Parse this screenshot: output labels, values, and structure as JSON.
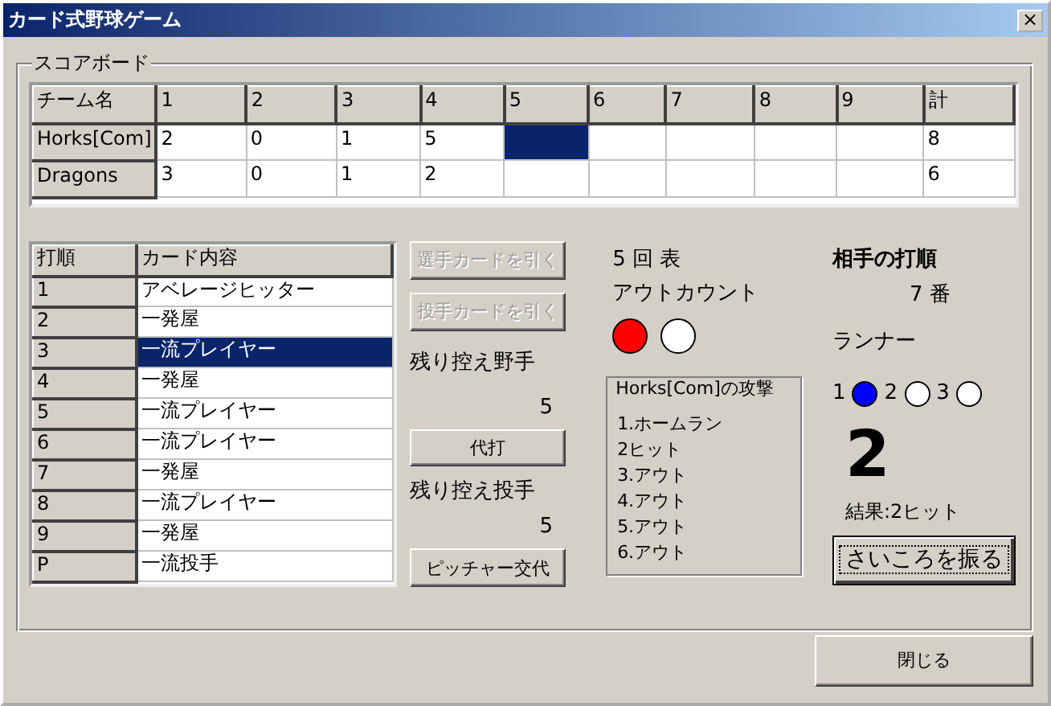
{
  "window": {
    "title": "カード式野球ゲーム",
    "close": "×"
  },
  "scoreboard": {
    "title": "スコアボード",
    "columns": [
      "チーム名",
      "1",
      "2",
      "3",
      "4",
      "5",
      "6",
      "7",
      "8",
      "9",
      "計"
    ],
    "rows": [
      {
        "cells": [
          {
            "text": "Horks[Com]",
            "selected": false
          },
          {
            "text": "2",
            "selected": false
          },
          {
            "text": "0",
            "selected": false
          },
          {
            "text": "1",
            "selected": false
          },
          {
            "text": "5",
            "selected": false
          },
          {
            "selected": true
          },
          {
            "selected": false
          },
          {
            "selected": false
          },
          {
            "selected": false
          },
          {
            "selected": false
          },
          {
            "text": "8",
            "selected": false
          }
        ]
      },
      {
        "cells": [
          {
            "text": "Dragons",
            "selected": false
          },
          {
            "text": "3",
            "selected": false
          },
          {
            "text": "0",
            "selected": false
          },
          {
            "text": "1",
            "selected": false
          },
          {
            "text": "2",
            "selected": false
          },
          {
            "selected": false
          },
          {
            "selected": false
          },
          {
            "selected": false
          },
          {
            "selected": false
          },
          {
            "selected": false
          },
          {
            "text": "6",
            "selected": false
          }
        ]
      }
    ],
    "lineup": {
      "columns": [
        "打順",
        "カード内容"
      ],
      "rows": [
        {
          "order": "1",
          "card": "アベレージヒッター",
          "selected": false
        },
        {
          "order": "2",
          "card": "一発屋",
          "selected": false
        },
        {
          "order": "3",
          "card": "一流プレイヤー",
          "selected": true
        },
        {
          "order": "4",
          "card": "一発屋",
          "selected": false
        },
        {
          "order": "5",
          "card": "一流プレイヤー",
          "selected": false
        },
        {
          "order": "6",
          "card": "一流プレイヤー",
          "selected": false
        },
        {
          "order": "7",
          "card": "一発屋",
          "selected": false
        },
        {
          "order": "8",
          "card": "一流プレイヤー",
          "selected": false
        },
        {
          "order": "9",
          "card": "一発屋",
          "selected": false
        },
        {
          "order": "P",
          "card": "一流投手",
          "selected": false
        }
      ]
    },
    "cards": {
      "draw_batter": {
        "label": "選手カードを引く",
        "disabled": true
      },
      "draw_pitcher": {
        "label": "投手カードを引く",
        "disabled": true
      },
      "bench_batters_label": "残り控え野手",
      "bench_batters": "5",
      "pinch_hit": {
        "label": "代打",
        "disabled": false
      },
      "bench_pitchers_label": "残り控え投手",
      "bench_pitchers": "5",
      "change_pitcher": {
        "label": "ピッチャー交代",
        "disabled": false
      }
    },
    "inning": "5 回 表",
    "outs": {
      "label": "アウトカウント",
      "lamps": [
        {
          "on": true
        },
        {
          "on": false
        }
      ]
    },
    "attack": {
      "title": "Horks[Com]の攻撃",
      "lines": [
        "1.ホームラン",
        "2ヒット",
        "3.アウト",
        "4.アウト",
        "5.アウト",
        "6.アウト"
      ]
    },
    "opponent": {
      "title": "相手の打順",
      "batter": "7 番"
    },
    "runners": {
      "label": "ランナー",
      "bases": [
        {
          "label": "1",
          "on": true
        },
        {
          "label": "2",
          "on": false
        },
        {
          "label": "3",
          "on": false
        }
      ]
    },
    "dice": {
      "value": "2",
      "result": "結果:2ヒット",
      "button": "さいころを振る"
    }
  },
  "close_button": "閉じる"
}
